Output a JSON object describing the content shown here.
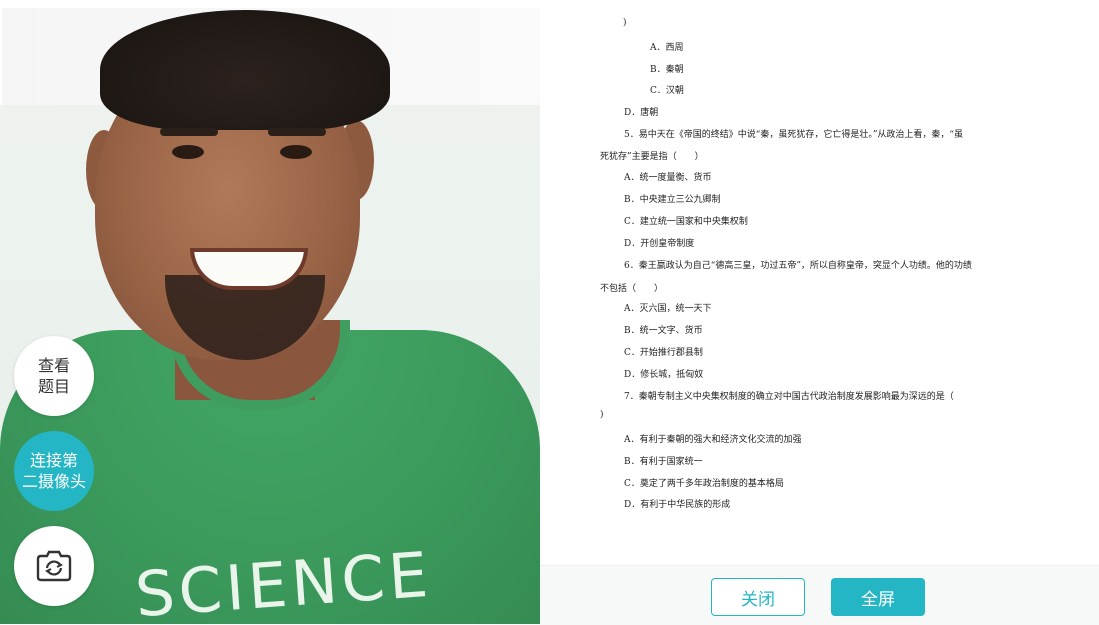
{
  "colors": {
    "accent": "#24b6c4"
  },
  "camera": {
    "shirt_text": "SCIENCE",
    "buttons": {
      "view_question": [
        "查看",
        "题目"
      ],
      "connect_second_camera": [
        "连接第",
        "二摄像头"
      ],
      "capture_icon": "camera-switch-icon"
    }
  },
  "document": {
    "lines": [
      ")",
      "A．西周",
      "B．秦朝",
      "C．汉朝",
      "D．唐朝",
      "5．易中天在《帝国的终结》中说“秦，虽死犹存，它亡得是壮。”从政治上看，秦，“虽",
      "死犹存”主要是指（　　）",
      "A．统一度量衡、货币",
      "B．中央建立三公九卿制",
      "C．建立统一国家和中央集权制",
      "D．开创皇帝制度",
      "6．秦王嬴政认为自己“德高三皇，功过五帝”，所以自称皇帝，突显个人功绩。他的功绩",
      "不包括（　　）",
      "A．灭六国，统一天下",
      "B．统一文字、货币",
      "C．开始推行郡县制",
      "D．修长城，抵匈奴",
      "7．秦朝专制主义中央集权制度的确立对中国古代政治制度发展影响最为深远的是（",
      ")",
      "A．有利于秦朝的强大和经济文化交流的加强",
      "B．有利于国家统一",
      "C．奠定了两千多年政治制度的基本格局",
      "D．有利于中华民族的形成"
    ]
  },
  "footer": {
    "close_label": "关闭",
    "fullscreen_label": "全屏"
  }
}
